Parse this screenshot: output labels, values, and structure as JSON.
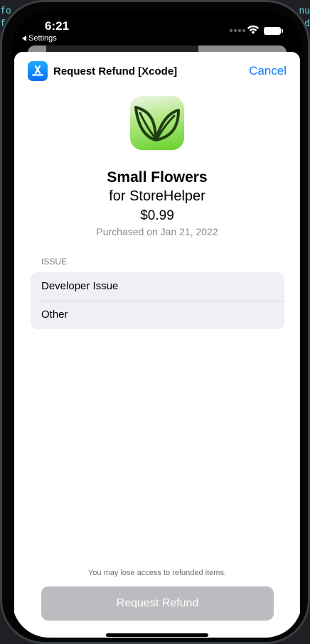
{
  "status_bar": {
    "time": "6:21",
    "back_label": "Settings"
  },
  "sheet": {
    "title": "Request Refund [Xcode]",
    "cancel_label": "Cancel"
  },
  "product": {
    "name": "Small Flowers",
    "app_line": "for StoreHelper",
    "price": "$0.99",
    "purchase_date": "Purchased on Jan 21, 2022"
  },
  "issue": {
    "header": "ISSUE",
    "options": [
      {
        "label": "Developer Issue"
      },
      {
        "label": "Other"
      }
    ]
  },
  "footer": {
    "disclaimer": "You may lose access to refunded items.",
    "button_label": "Request Refund"
  },
  "colors": {
    "accent": "#0a7aff",
    "button_disabled": "#bcbcc0",
    "list_background": "#efeff4"
  },
  "icons": [
    "app-store-icon",
    "leaf-app-icon",
    "wifi-icon",
    "battery-icon",
    "back-arrow-icon"
  ]
}
